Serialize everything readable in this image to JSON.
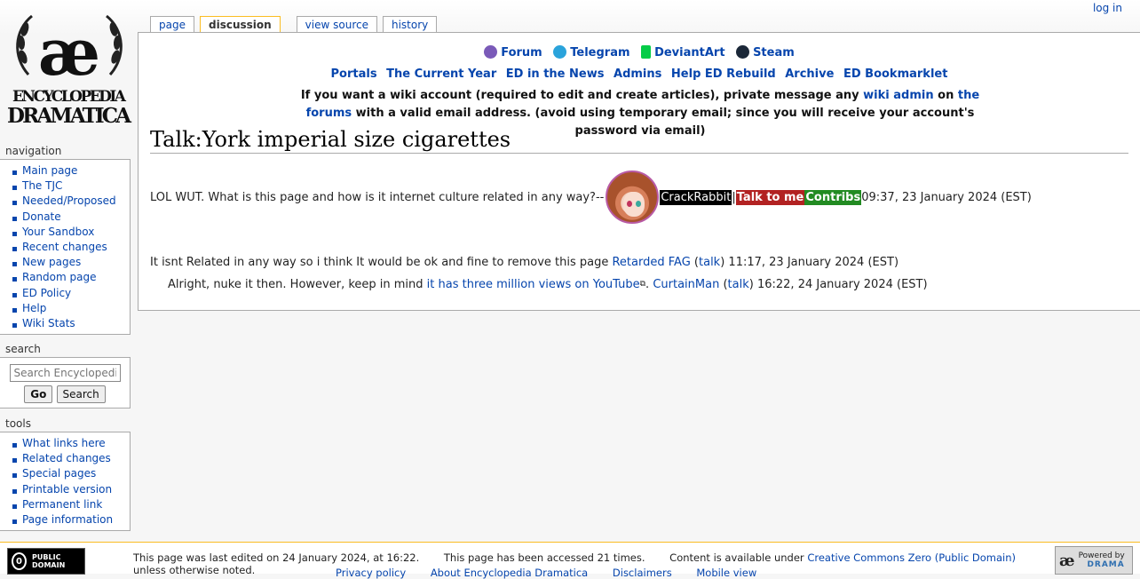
{
  "logo": {
    "line1": "ENCYCLOPEDIA",
    "line2": "DRAMATICA",
    "mark": "æ"
  },
  "tabs": [
    {
      "label": "page"
    },
    {
      "label": "discussion"
    },
    {
      "label": "view source"
    },
    {
      "label": "history"
    }
  ],
  "personal": {
    "login": "log in"
  },
  "notice": {
    "social": [
      {
        "label": "Forum",
        "icon": "forum-icon",
        "color": "#7a5ab8"
      },
      {
        "label": "Telegram",
        "icon": "telegram-icon",
        "color": "#2aa3db"
      },
      {
        "label": "DeviantArt",
        "icon": "deviantart-icon",
        "color": "#05cc47"
      },
      {
        "label": "Steam",
        "icon": "steam-icon",
        "color": "#1b2838"
      }
    ],
    "links": [
      "Portals",
      "The Current Year",
      "ED in the News",
      "Admins",
      "Help ED Rebuild",
      "Archive",
      "ED Bookmarklet"
    ],
    "account_msg": {
      "part1": "If you want a wiki account (required to edit and create articles), private message any ",
      "link1": "wiki admin",
      "part2": " on ",
      "link2": "the forums",
      "part3": " with a valid email address. (avoid using temporary email; since you will receive your account's password via email)"
    }
  },
  "page_title": "Talk:York imperial size cigarettes",
  "comments": {
    "c1": {
      "text": "LOL WUT. What is this page and how is it internet culture related in any way?--",
      "user": "CrackRabbit",
      "sep": " | ",
      "talk": "Talk to me",
      "contribs": "Contribs",
      "timestamp": " 09:37, 23 January 2024 (EST)"
    },
    "c2": {
      "text": "It isnt Related in any way so i think It would be ok and fine to remove this page ",
      "user": "Retarded FAG",
      "talk_open": " (",
      "talk": "talk",
      "talk_close": ")",
      "timestamp": " 11:17, 23 January 2024 (EST)"
    },
    "c3": {
      "text": "Alright, nuke it then. However, keep in mind ",
      "link": "it has three million views on YouTube",
      "period": ". ",
      "user": "CurtainMan",
      "talk_open": " (",
      "talk": "talk",
      "talk_close": ")",
      "timestamp": " 16:22, 24 January 2024 (EST)"
    }
  },
  "sidebar": {
    "navigation_heading": "navigation",
    "navigation": [
      "Main page",
      "The TJC",
      "Needed/Proposed",
      "Donate",
      "Your Sandbox",
      "Recent changes",
      "New pages",
      "Random page",
      "ED Policy",
      "Help",
      "Wiki Stats"
    ],
    "search_heading": "search",
    "search_placeholder": "Search Encyclopedi",
    "go_label": "Go",
    "search_label": "Search",
    "tools_heading": "tools",
    "tools": [
      "What links here",
      "Related changes",
      "Special pages",
      "Printable version",
      "Permanent link",
      "Page information"
    ]
  },
  "footer": {
    "last_edited": "This page was last edited on 24 January 2024, at 16:22.",
    "accessed": "This page has been accessed 21 times.",
    "license_pre": "Content is available under ",
    "license_link": "Creative Commons Zero (Public Domain)",
    "license_post": " unless otherwise noted.",
    "links": [
      "Privacy policy",
      "About Encyclopedia Dramatica",
      "Disclaimers",
      "Mobile view"
    ],
    "pd_badge": "PUBLIC DOMAIN",
    "powered_by": "Powered by",
    "powered_name": "DRAMA"
  }
}
